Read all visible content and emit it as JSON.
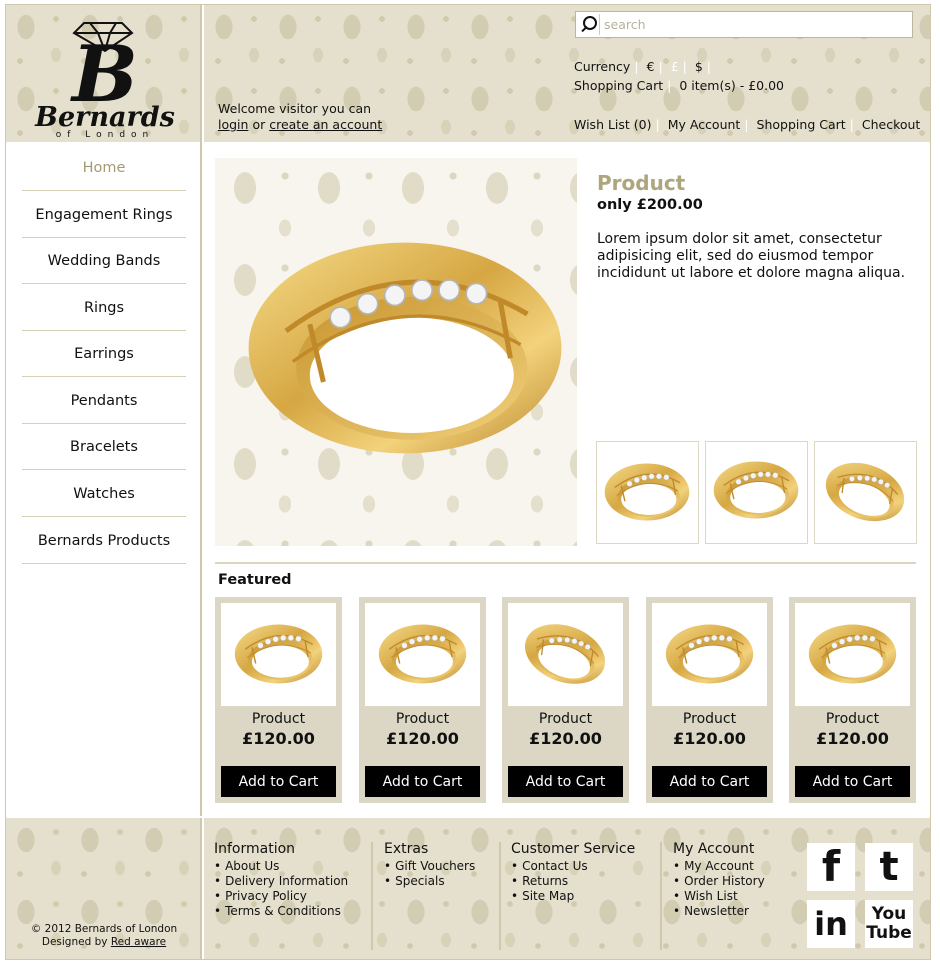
{
  "brand": {
    "logo_letter": "B",
    "name": "Bernards",
    "tagline": "of London"
  },
  "header": {
    "welcome_line": "Welcome visitor you can",
    "login_label": "login",
    "or_text": "or",
    "create_account_label": "create an account",
    "search_placeholder": "search",
    "currency_label": "Currency",
    "currencies": [
      "€",
      "£",
      "$"
    ],
    "cart_label": "Shopping Cart",
    "cart_summary": "0 item(s) - £0.00",
    "links": [
      "Wish List (0)",
      "My Account",
      "Shopping Cart",
      "Checkout"
    ]
  },
  "sidebar": {
    "items": [
      {
        "label": "Home",
        "active": true
      },
      {
        "label": "Engagement Rings"
      },
      {
        "label": "Wedding Bands"
      },
      {
        "label": "Rings"
      },
      {
        "label": "Earrings"
      },
      {
        "label": "Pendants"
      },
      {
        "label": "Bracelets"
      },
      {
        "label": "Watches"
      },
      {
        "label": "Bernards Products"
      }
    ]
  },
  "product": {
    "title": "Product",
    "price": "only £200.00",
    "description": "Lorem ipsum dolor sit amet, consectetur adipisicing elit, sed do eiusmod tempor incididunt ut labore et dolore magna aliqua."
  },
  "featured": {
    "title": "Featured",
    "items": [
      {
        "name": "Product",
        "price": "£120.00",
        "button": "Add to Cart"
      },
      {
        "name": "Product",
        "price": "£120.00",
        "button": "Add to Cart"
      },
      {
        "name": "Product",
        "price": "£120.00",
        "button": "Add to Cart"
      },
      {
        "name": "Product",
        "price": "£120.00",
        "button": "Add to Cart"
      },
      {
        "name": "Product",
        "price": "£120.00",
        "button": "Add to Cart"
      }
    ]
  },
  "footer": {
    "columns": [
      {
        "title": "Information",
        "links": [
          "About Us",
          "Delivery Information",
          "Privacy Policy",
          "Terms & Conditions"
        ]
      },
      {
        "title": "Extras",
        "links": [
          "Gift Vouchers",
          "Specials"
        ]
      },
      {
        "title": "Customer Service",
        "links": [
          "Contact Us",
          "Returns",
          "Site Map"
        ]
      },
      {
        "title": "My Account",
        "links": [
          "My Account",
          "Order History",
          "Wish List",
          "Newsletter"
        ]
      }
    ],
    "copyright": "© 2012 Bernards of London",
    "designed_by": "Designed by",
    "designer": "Red aware",
    "social": {
      "facebook": "f",
      "twitter": "t",
      "linkedin": "in",
      "youtube_top": "You",
      "youtube_bottom": "Tube"
    }
  },
  "colors": {
    "accent_gold": "#ada57c",
    "pattern_bg": "#e5e0cd",
    "card_bg": "#dcd7c4",
    "button_bg": "#000000"
  }
}
